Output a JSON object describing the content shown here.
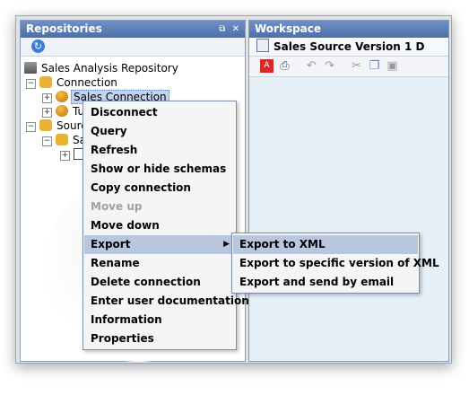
{
  "repositories": {
    "title": "Repositories",
    "title_icons": "⧉ ✕",
    "tree": [
      {
        "label": "Sales Analysis Repository",
        "type": "repository"
      },
      {
        "label": "Connection",
        "type": "folder"
      },
      {
        "label": "Sales Connection",
        "type": "connection",
        "selected": true
      },
      {
        "label": "Tu",
        "type": "connection"
      },
      {
        "label": "Sourc",
        "type": "folder"
      },
      {
        "label": "Sa",
        "type": "source"
      },
      {
        "label": "",
        "type": "item"
      }
    ]
  },
  "workspace": {
    "title": "Workspace",
    "tab_label": "Sales Source Version 1 D"
  },
  "context_menu": {
    "items": [
      {
        "label": "Disconnect",
        "enabled": true
      },
      {
        "label": "Query",
        "enabled": true
      },
      {
        "label": "Refresh",
        "enabled": true
      },
      {
        "label": "Show or hide schemas",
        "enabled": true
      },
      {
        "label": "Copy connection",
        "enabled": true
      },
      {
        "label": "Move up",
        "enabled": false
      },
      {
        "label": "Move down",
        "enabled": true
      },
      {
        "label": "Export",
        "enabled": true,
        "has_submenu": true,
        "active": true
      },
      {
        "label": "Rename",
        "enabled": true
      },
      {
        "label": "Delete connection",
        "enabled": true
      },
      {
        "label": "Enter user documentation",
        "enabled": true
      },
      {
        "label": "Information",
        "enabled": true
      },
      {
        "label": "Properties",
        "enabled": true
      }
    ]
  },
  "export_submenu": {
    "items": [
      {
        "label": "Export to XML",
        "active": true
      },
      {
        "label": "Export to specific version of XML"
      },
      {
        "label": "Export and send by email"
      }
    ]
  },
  "colors": {
    "title_bar": "#5577b0",
    "menu_highlight": "#b8c7de",
    "workspace_bg": "#e6f0f8"
  }
}
